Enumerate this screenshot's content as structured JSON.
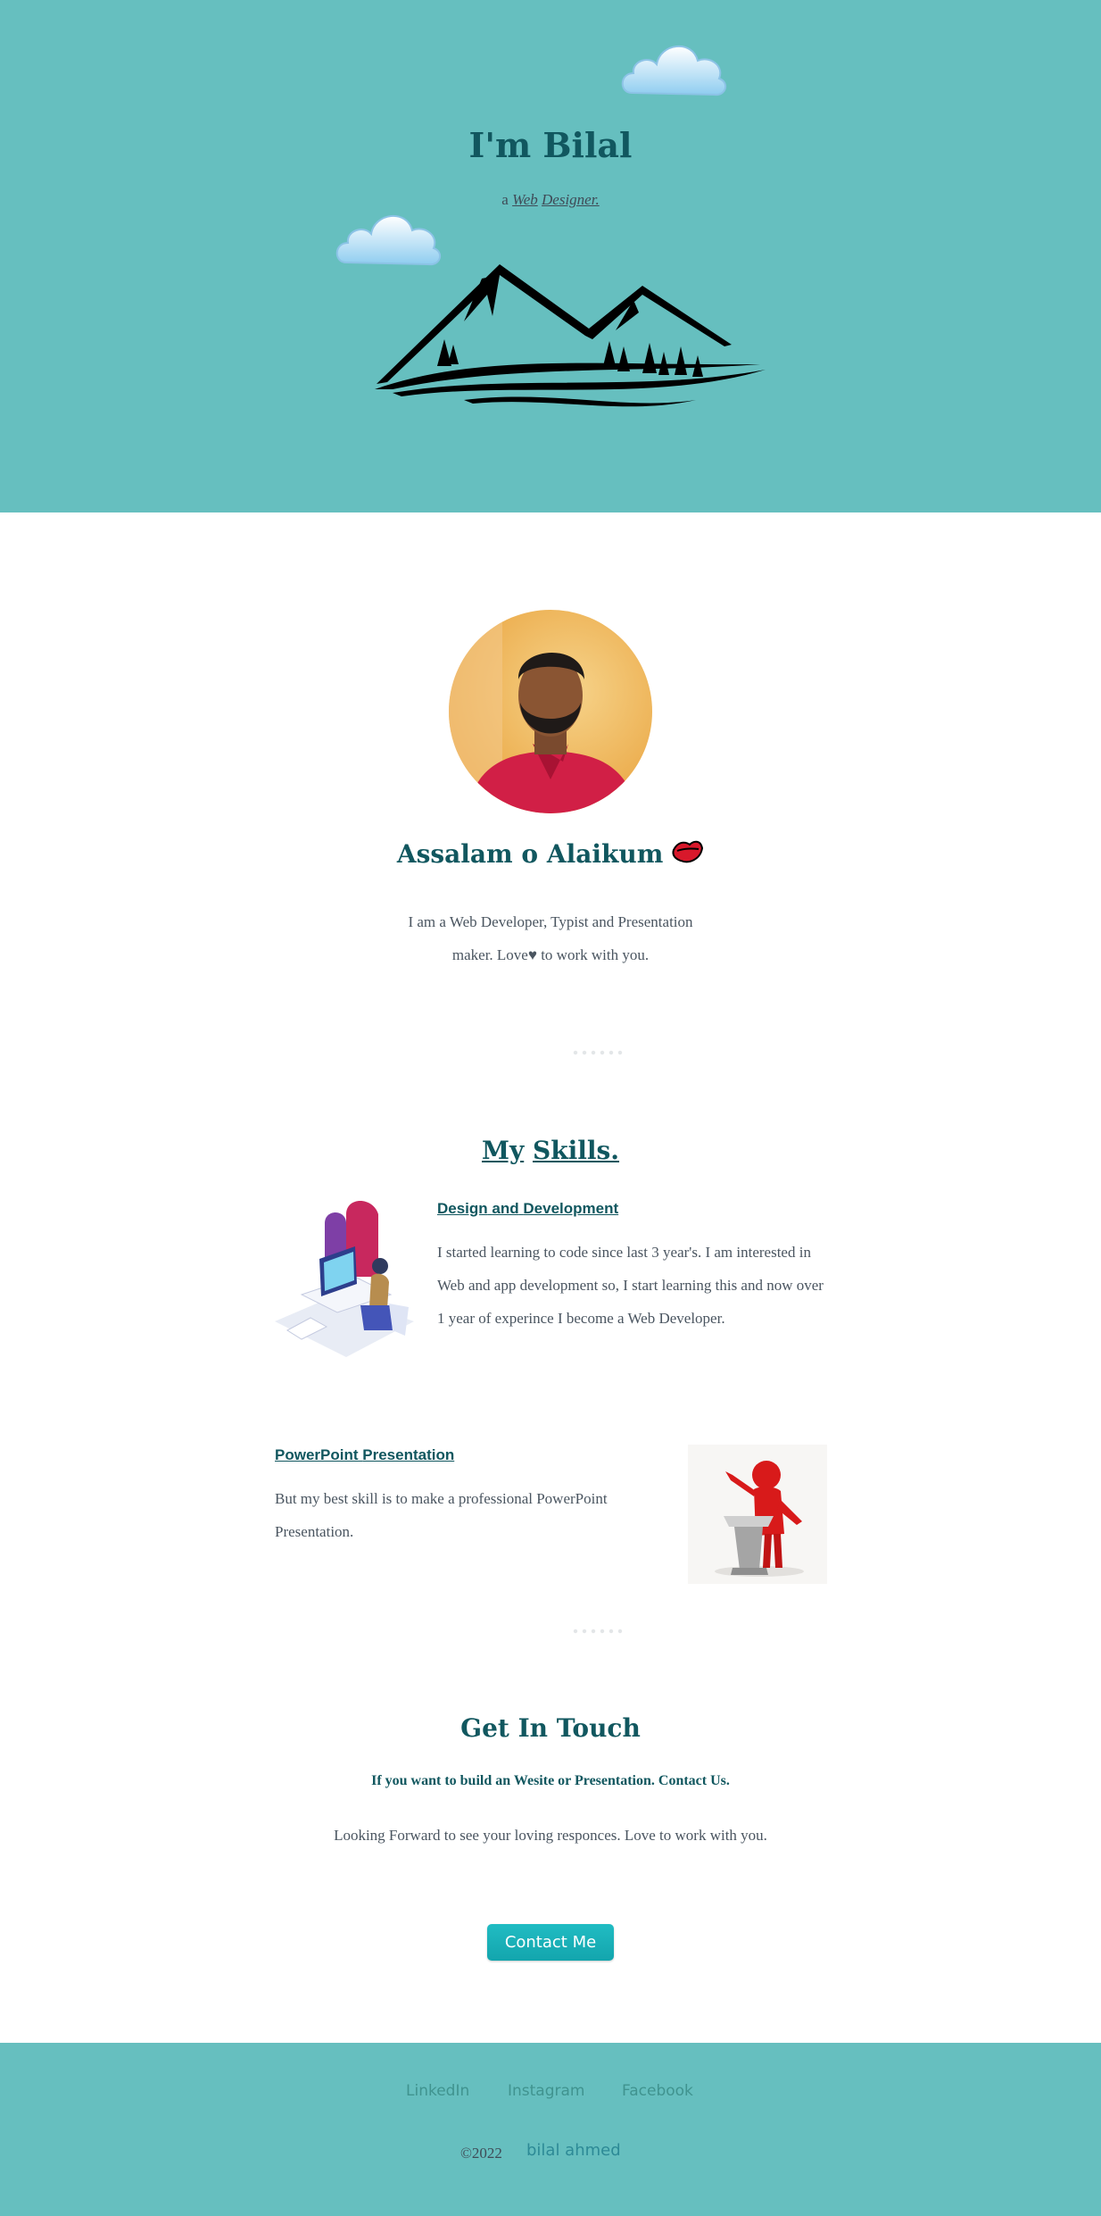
{
  "hero": {
    "title": "I'm Bilal",
    "tagline_prefix": "a",
    "tagline_word1": "Web",
    "tagline_word2": "Designer."
  },
  "about": {
    "greeting": "Assalam o Alaikum",
    "intro": "I am a Web Developer, Typist and Presentation maker. Love♥ to work with you."
  },
  "skills": {
    "title_word1": "My",
    "title_word2": "Skills.",
    "items": [
      {
        "title_words": [
          "Design",
          "and",
          "Development"
        ],
        "text": "I started learning to code since last 3 year's. I am interested in Web and app development so, I start learning this and now over 1 year of experince I become a Web Developer."
      },
      {
        "title_words": [
          "PowerPoint",
          "Presentation"
        ],
        "text": "But my best skill is to make a professional PowerPoint Presentation."
      }
    ]
  },
  "contact": {
    "title": "Get In Touch",
    "subtitle": "If you want to build an Wesite or Presentation. Contact Us.",
    "text": "Looking Forward to see your loving responces. Love to work with you.",
    "button_label": "Contact Me"
  },
  "footer": {
    "links": [
      "LinkedIn",
      "Instagram",
      "Facebook"
    ],
    "copyright": "©2022",
    "author": "bilal ahmed"
  },
  "colors": {
    "teal_background": "#66bfbf",
    "heading": "#11575f",
    "button": "#13a5ad"
  }
}
